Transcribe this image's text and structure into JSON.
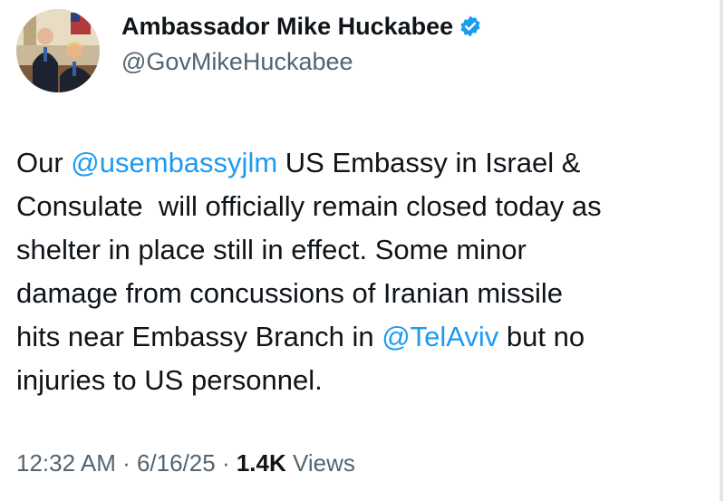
{
  "author": {
    "display_name": "Ambassador Mike Huckabee",
    "handle": "@GovMikeHuckabee",
    "verified_icon": "verified-badge-icon",
    "avatar": "profile-photo"
  },
  "tweet": {
    "lines": [
      [
        {
          "t": "Our "
        },
        {
          "t": "@usembassyjlm",
          "mention": true
        },
        {
          "t": " US Embassy in Israel &"
        }
      ],
      [
        {
          "t": "Consulate  will officially remain closed today as"
        }
      ],
      [
        {
          "t": "shelter in place still in effect. Some minor"
        }
      ],
      [
        {
          "t": "damage from concussions of Iranian missile"
        }
      ],
      [
        {
          "t": "hits near Embassy Branch in "
        },
        {
          "t": "@TelAviv",
          "mention": true
        },
        {
          "t": " but no"
        }
      ],
      [
        {
          "t": "injuries to US personnel."
        }
      ]
    ]
  },
  "meta": {
    "time": "12:32 AM",
    "separator": " · ",
    "date": "6/16/25",
    "views_count": "1.4K",
    "views_label": " Views"
  },
  "colors": {
    "accent": "#1d9bf0",
    "text": "#0f1419",
    "muted": "#536471"
  }
}
